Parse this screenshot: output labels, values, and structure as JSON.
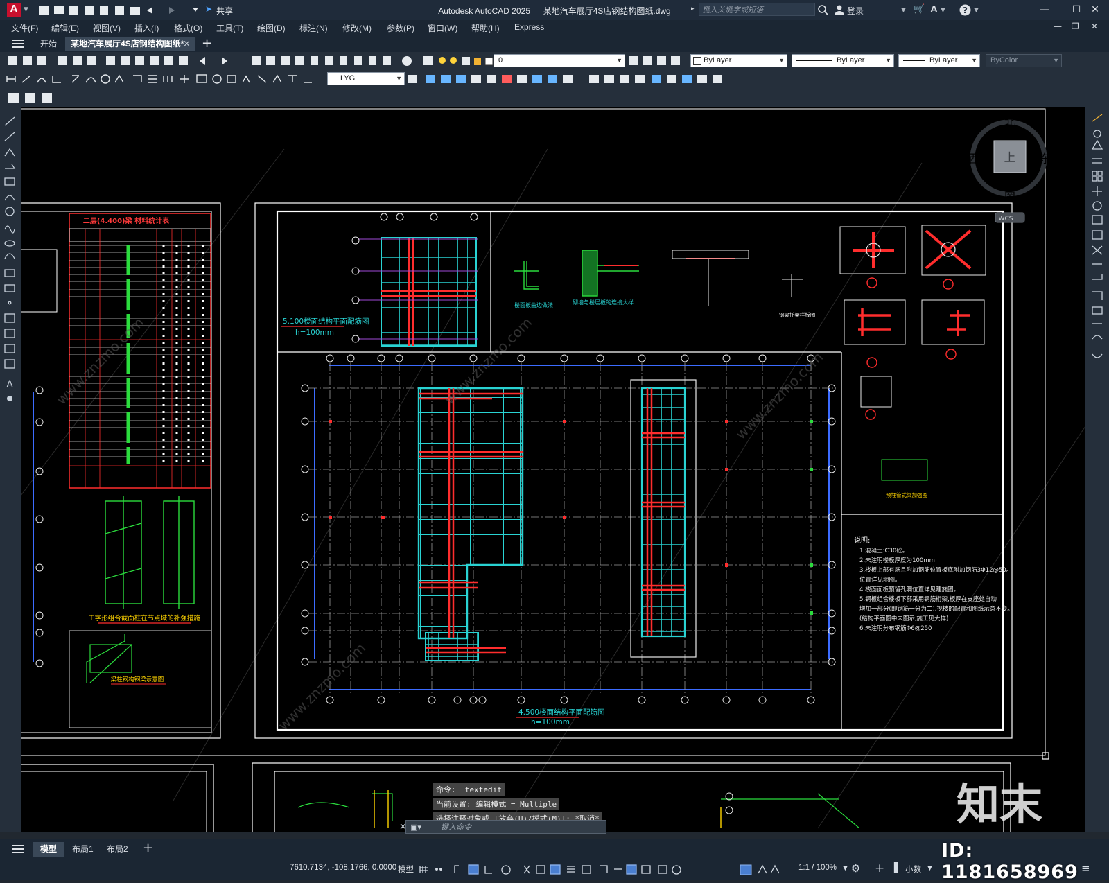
{
  "titlebar": {
    "app_title": "Autodesk AutoCAD 2025",
    "file_title": "某地汽车展厅4S店钢结构图纸.dwg",
    "share_label": "共享",
    "search_placeholder": "键入关键字或短语",
    "login_label": "登录",
    "app_logo": "A"
  },
  "menu": [
    "文件(F)",
    "编辑(E)",
    "视图(V)",
    "插入(I)",
    "格式(O)",
    "工具(T)",
    "绘图(D)",
    "标注(N)",
    "修改(M)",
    "参数(P)",
    "窗口(W)",
    "帮助(H)",
    "Express"
  ],
  "file_tabs": {
    "start_label": "开始",
    "active_label": "某地汽车展厅4S店钢结构图纸*",
    "close": "×",
    "add": "+"
  },
  "toolbar": {
    "layer_value": "0",
    "color_value": "ByLayer",
    "linetype_value": "ByLayer",
    "lineweight_value": "ByLayer",
    "plotstyle_value": "ByColor",
    "dimstyle_value": "LYG"
  },
  "viewcube": {
    "north": "北",
    "south": "南",
    "east": "东",
    "west": "西",
    "face": "上",
    "ucs": "WCS"
  },
  "drawing": {
    "table_title": "二层(4.400)梁 材料统计表",
    "plan_top_title": "5.100楼面结构平面配筋图",
    "plan_top_sub": "h=100mm",
    "plan_main_title": "4.500楼面结构平面配筋图",
    "plan_main_sub": "h=100mm",
    "notes_title": "说明:",
    "notes": [
      "1.混凝土:C30砼。",
      "2.未注明楼板厚度为100mm",
      "3.楼板上部有筋且附加钢筋位置板底附加钢筋3Φ12@50。",
      "  位置详见地图。",
      "4.楼面面板预留孔洞位置详见建施图。",
      "5.钢板组合楼板下部采用钢筋桁架,板厚在支座处自动",
      "  增加一部分(即钢筋一分为二),视楼的配置和图纸示意不变。",
      "  (结构平面图中未图示,施工见大样)",
      "6.未注明分布钢筋Φ6@250"
    ],
    "detail_title_1": "工字形组合截面柱在节点域的补强措施",
    "detail_title_2": "梁柱钢构钢梁示意图",
    "detail_label_a": "楼面板曲边做法",
    "detail_label_b": "砌墙与楼层板的连接大样",
    "detail_label_c": "钢梁托架样板图",
    "detail_label_d": "预埋管式梁加强图"
  },
  "command": {
    "line1": "命令: _textedit",
    "line2": "当前设置: 编辑模式 = Multiple",
    "line3": "选择注释对象或 [放弃(U)/模式(M)]: *取消*",
    "input_placeholder": "键入命令"
  },
  "layout_tabs": [
    "模型",
    "布局1",
    "布局2"
  ],
  "statusbar": {
    "coords": "7610.7134, -108.1766, 0.0000",
    "space": "模型",
    "scale": "1:1 / 100%",
    "units": "小数"
  },
  "watermarks": {
    "brand": "知末",
    "id": "ID: 1181658969",
    "site": "www.znzmo.com"
  },
  "colors": {
    "accent_red": "#c8102e",
    "cad_cyan": "#29d3d3",
    "cad_red": "#ff1c1c",
    "cad_green": "#2bdc3d",
    "cad_white": "#ffffff"
  }
}
